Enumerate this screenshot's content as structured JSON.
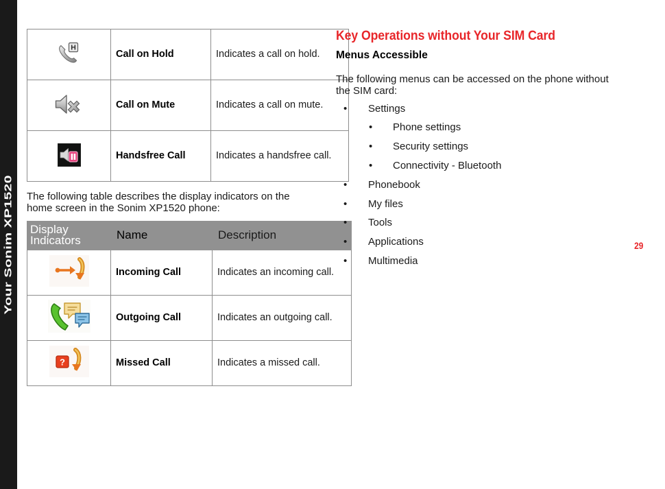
{
  "sidebar": {
    "label": "Your Sonim XP1520"
  },
  "page_number": "29",
  "colors": {
    "accent_red": "#e8262a",
    "table_header_gray": "#919191",
    "sidebar_black": "#1a1a1a",
    "table_border": "#8d8d8d"
  },
  "left_column": {
    "top_table": {
      "rows": [
        {
          "icon": "call-on-hold-icon",
          "name": "Call on Hold",
          "description": "Indicates a call on hold."
        },
        {
          "icon": "call-on-mute-icon",
          "name": "Call on Mute",
          "description": "Indicates a call on mute."
        },
        {
          "icon": "handsfree-call-icon",
          "name": "Handsfree Call",
          "description": "Indicates a handsfree call."
        }
      ]
    },
    "intro_paragraph": "The following table describes the display indicators on the home screen in the Sonim XP1520 phone:",
    "bottom_table": {
      "headers": [
        "Display Indicators",
        "Name",
        "Description"
      ],
      "rows": [
        {
          "icon": "incoming-call-icon",
          "name": "Incoming Call",
          "description": "Indicates an incoming call."
        },
        {
          "icon": "outgoing-call-icon",
          "name": "Outgoing Call",
          "description": "Indicates an outgoing call."
        },
        {
          "icon": "missed-call-icon",
          "name": "Missed Call",
          "description": "Indicates a missed call."
        }
      ]
    }
  },
  "right_column": {
    "heading": "Key Operations without Your SIM Card",
    "subheading": "Menus Accessible",
    "paragraph": "The following menus can be accessed on the phone without the SIM card:",
    "bullets": [
      {
        "label": "Settings",
        "marker": "•",
        "children": [
          {
            "label": "Phone settings",
            "marker": "•"
          },
          {
            "label": "Security settings",
            "marker": "•"
          },
          {
            "label": "Connectivity - Bluetooth",
            "marker": "•"
          }
        ]
      },
      {
        "label": "Phonebook",
        "marker": "•",
        "children": []
      },
      {
        "label": "My files",
        "marker": "•",
        "children": []
      },
      {
        "label": "Tools",
        "marker": "•",
        "children": []
      },
      {
        "label": "Applications",
        "marker": "•",
        "children": []
      },
      {
        "label": "Multimedia",
        "marker": "•",
        "children": []
      }
    ]
  }
}
